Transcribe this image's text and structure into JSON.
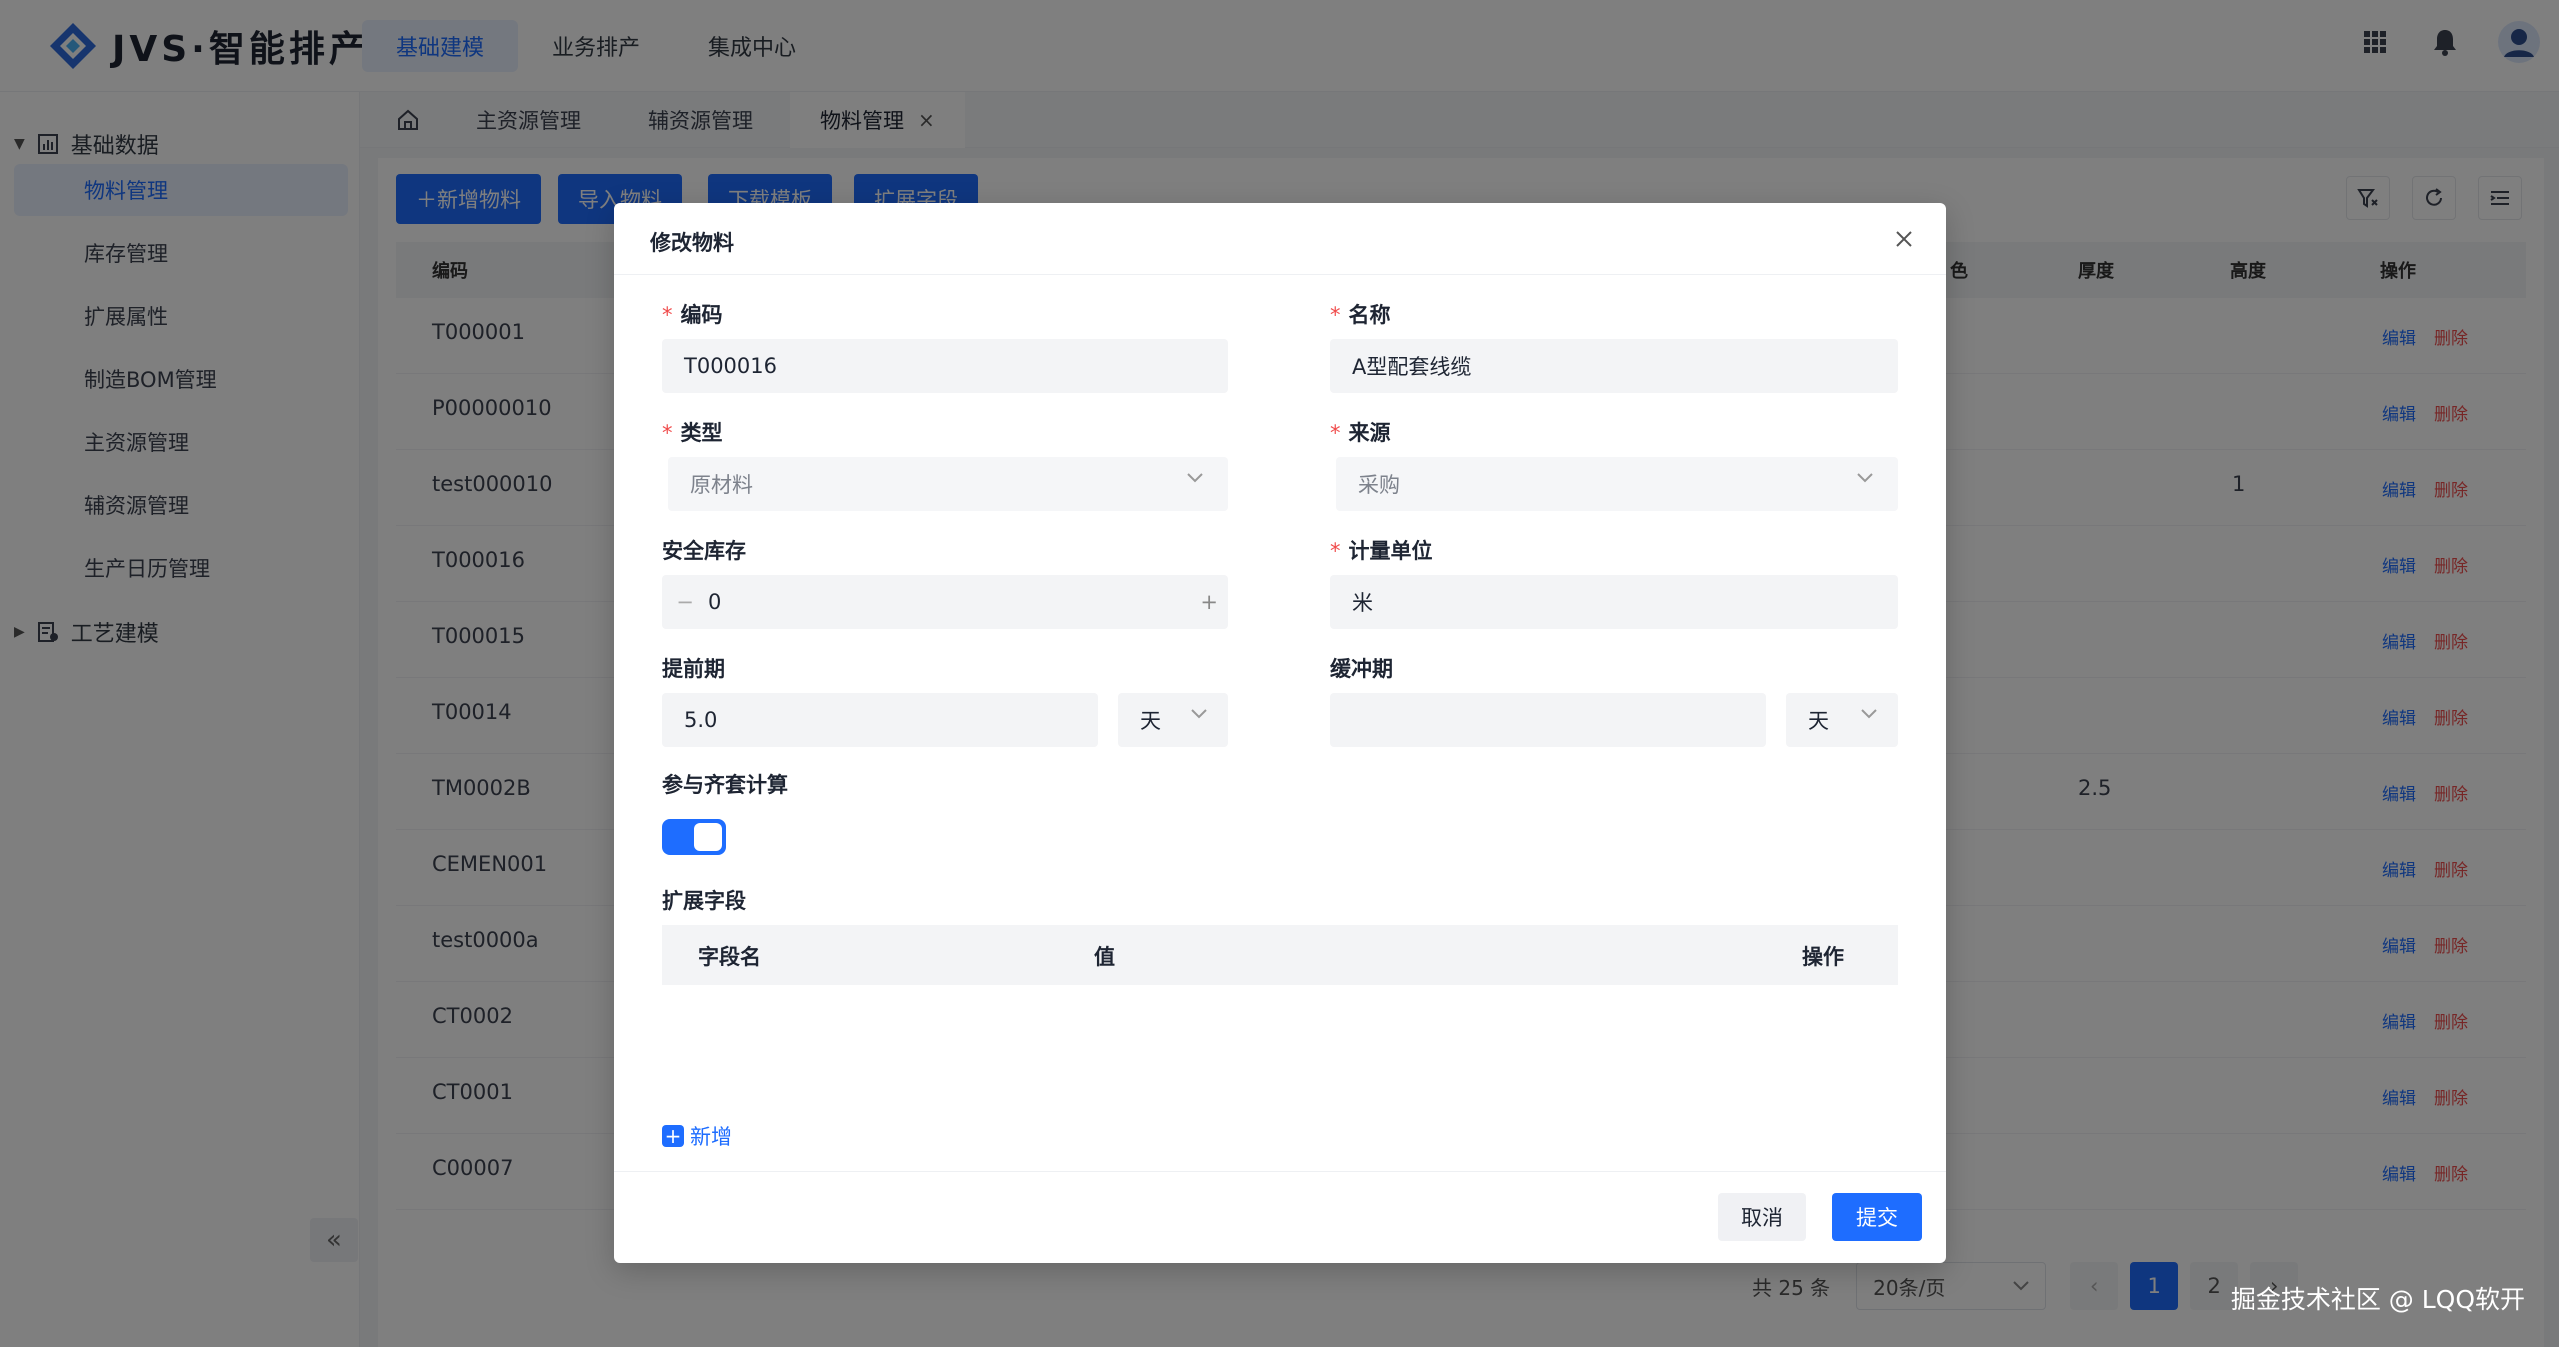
{
  "brand": {
    "text": "JVS·智能排产"
  },
  "topnav": {
    "items": [
      "基础建模",
      "业务排产",
      "集成中心"
    ]
  },
  "sidebar": {
    "group1": "基础数据",
    "items": [
      "物料管理",
      "库存管理",
      "扩展属性",
      "制造BOM管理",
      "主资源管理",
      "辅资源管理",
      "生产日历管理"
    ],
    "group2": "工艺建模",
    "collapse": "«"
  },
  "tabs": {
    "items": [
      "主资源管理",
      "辅资源管理",
      "物料管理"
    ],
    "close": "×"
  },
  "toolbar": {
    "buttons": [
      "＋新增物料",
      "导入物料",
      "下载模板",
      "扩展字段"
    ]
  },
  "table": {
    "headers": {
      "code": "编码",
      "color": "色",
      "thickness": "厚度",
      "height": "高度",
      "action": "操作"
    },
    "rows": [
      {
        "code": "T000001",
        "thickness": "",
        "height": ""
      },
      {
        "code": "P00000010",
        "thickness": "",
        "height": ""
      },
      {
        "code": "test000010",
        "thickness": "",
        "height": "1"
      },
      {
        "code": "T000016",
        "thickness": "",
        "height": ""
      },
      {
        "code": "T000015",
        "thickness": "",
        "height": ""
      },
      {
        "code": "T00014",
        "thickness": "",
        "height": ""
      },
      {
        "code": "TM0002B",
        "thickness": "2.5",
        "height": ""
      },
      {
        "code": "CEMEN001",
        "thickness": "",
        "height": ""
      },
      {
        "code": "test0000a",
        "thickness": "",
        "height": ""
      },
      {
        "code": "CT0002",
        "thickness": "",
        "height": ""
      },
      {
        "code": "CT0001",
        "thickness": "",
        "height": ""
      },
      {
        "code": "C00007",
        "thickness": "",
        "height": ""
      }
    ],
    "edit_label": "编辑",
    "delete_label": "删除"
  },
  "pagination": {
    "total": "共 25 条",
    "page_size": "20条/页",
    "pages": [
      "1",
      "2"
    ],
    "current": "1"
  },
  "modal": {
    "title": "修改物料",
    "fields": {
      "code": {
        "label": "编码",
        "value": "T000016"
      },
      "name": {
        "label": "名称",
        "value": "A型配套线缆"
      },
      "type": {
        "label": "类型",
        "value": "原材料"
      },
      "source": {
        "label": "来源",
        "value": "采购"
      },
      "safety_stock": {
        "label": "安全库存",
        "value": "0",
        "minus": "−",
        "plus": "+"
      },
      "unit": {
        "label": "计量单位",
        "value": "米"
      },
      "lead_time": {
        "label": "提前期",
        "value": "5.0",
        "unit": "天"
      },
      "buffer": {
        "label": "缓冲期",
        "value": "",
        "unit": "天"
      },
      "kit_calc": {
        "label": "参与齐套计算",
        "enabled": true
      },
      "ext": {
        "label": "扩展字段",
        "col_name": "字段名",
        "col_value": "值",
        "col_action": "操作"
      }
    },
    "add_label": "新增",
    "required_mark": "*",
    "cancel": "取消",
    "submit": "提交"
  },
  "watermark": "掘金技术社区 @ LQQ软开",
  "colors": {
    "primary": "#1e6dff",
    "danger": "#ee4d4d",
    "overlay": "rgba(0,0,0,0.5)"
  }
}
